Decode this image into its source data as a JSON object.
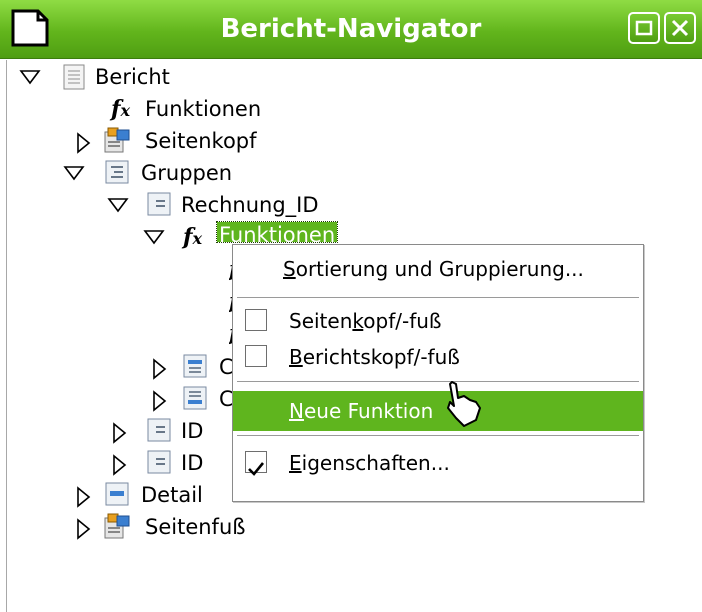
{
  "window": {
    "title": "Bericht-Navigator"
  },
  "tree": {
    "bericht": "Bericht",
    "funktionen_top": "Funktionen",
    "seitenkopf": "Seitenkopf",
    "gruppen": "Gruppen",
    "rechnung_id": "Rechnung_ID",
    "funktionen_group": "Funktionen",
    "partial_c1": "C",
    "partial_c2": "C",
    "id1": "ID",
    "id2": "ID",
    "detail": "Detail",
    "seitenfuss": "Seitenfuß"
  },
  "context_menu": {
    "sortierung": {
      "pre": "",
      "key": "S",
      "post": "ortierung und Gruppierung..."
    },
    "seitenkopf": {
      "pre": "Seiten",
      "key": "k",
      "post": "opf/-fuß",
      "checked": false
    },
    "berichtskopf": {
      "pre": "",
      "key": "B",
      "post": "erichtskopf/-fuß",
      "checked": false
    },
    "neue_funktion": {
      "pre": "",
      "key": "N",
      "post": "eue Funktion"
    },
    "eigenschaften": {
      "pre": "",
      "key": "E",
      "post": "igenschaften...",
      "checked": true
    }
  },
  "colors": {
    "title_green": "#62b51c",
    "highlight_green": "#5fb51e"
  }
}
